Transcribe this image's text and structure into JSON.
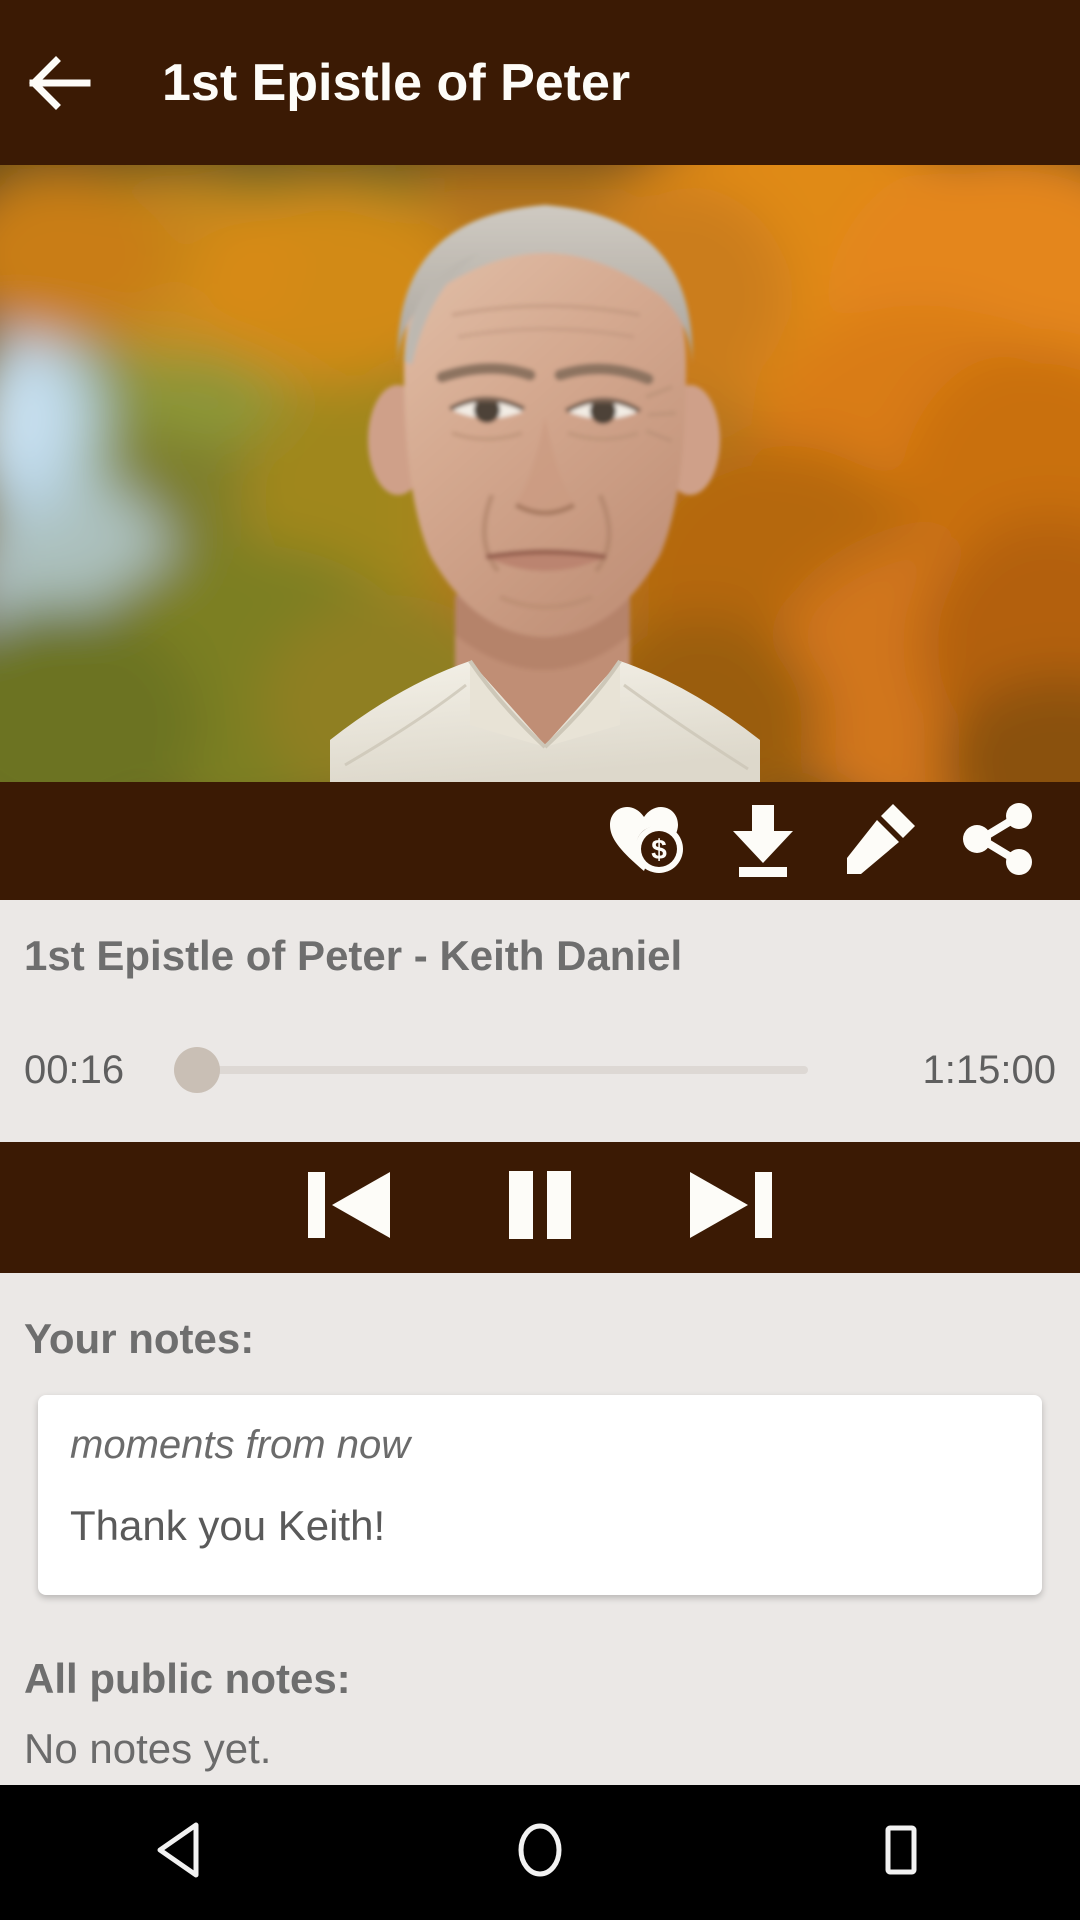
{
  "appbar": {
    "back_icon": "arrow-left-icon",
    "title": "1st Epistle of Peter"
  },
  "hero": {
    "image_alt": "portrait-photo-speaker",
    "description": "Older man with grey hair in white collared shirt in front of blurred orange autumn foliage"
  },
  "actions": [
    {
      "name": "donate-button",
      "icon": "heart-dollar-icon",
      "label": "Donate"
    },
    {
      "name": "download-button",
      "icon": "download-icon",
      "label": "Download"
    },
    {
      "name": "edit-button",
      "icon": "pencil-icon",
      "label": "Edit"
    },
    {
      "name": "share-button",
      "icon": "share-icon",
      "label": "Share"
    }
  ],
  "player": {
    "track_title": "1st Epistle of Peter - Keith Daniel",
    "current_time": "00:16",
    "total_time": "1:15:00",
    "progress_percent": 0,
    "controls": [
      {
        "name": "previous-button",
        "icon": "skip-previous-icon",
        "label": "Previous"
      },
      {
        "name": "pause-button",
        "icon": "pause-icon",
        "label": "Pause"
      },
      {
        "name": "next-button",
        "icon": "skip-next-icon",
        "label": "Next"
      }
    ]
  },
  "notes": {
    "your_notes_heading": "Your notes:",
    "user_note": {
      "timestamp": "moments from now",
      "text": "Thank you Keith!"
    },
    "public_notes_heading": "All public notes:",
    "public_notes_empty": "No notes yet."
  },
  "navbar": [
    {
      "name": "nav-back-button",
      "icon": "triangle-back-icon",
      "label": "Back"
    },
    {
      "name": "nav-home-button",
      "icon": "circle-home-icon",
      "label": "Home"
    },
    {
      "name": "nav-recents-button",
      "icon": "square-recents-icon",
      "label": "Recents"
    }
  ],
  "colors": {
    "brand_brown": "#3b1a04",
    "page_background": "#ebe8e6",
    "text_gray": "#6e6e6e",
    "card_white": "#ffffff",
    "navbar_black": "#000000",
    "thumb_tan": "#c9bfb5"
  }
}
